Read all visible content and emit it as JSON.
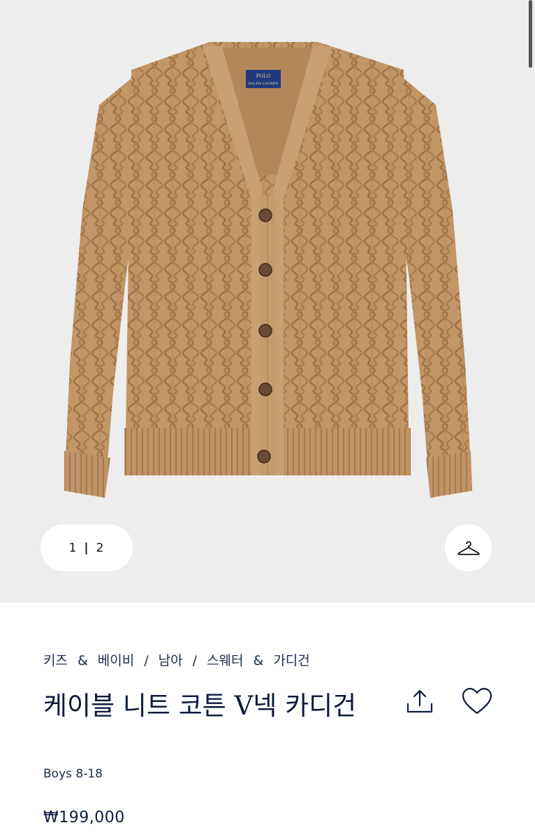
{
  "pager": {
    "current": "1",
    "separator": "|",
    "total": "2"
  },
  "breadcrumb": {
    "items": [
      "키즈",
      "&",
      "베이비",
      "/",
      "남아",
      "/",
      "스웨터",
      "&",
      "가디건"
    ]
  },
  "product": {
    "title": "케이블 니트 코튼 V넥 카디건",
    "subtitle": "Boys 8-18",
    "price": "₩199,000",
    "label_line1": "POLO",
    "label_line2": "RALPH LAUREN"
  },
  "icons": {
    "hanger": "hanger-icon",
    "share": "share-icon",
    "wishlist": "heart-icon"
  },
  "colors": {
    "gallery_bg": "#ededed",
    "sweater": "#c29666",
    "text_navy": "#0d1b3e",
    "label_navy": "#1f3a7a"
  }
}
